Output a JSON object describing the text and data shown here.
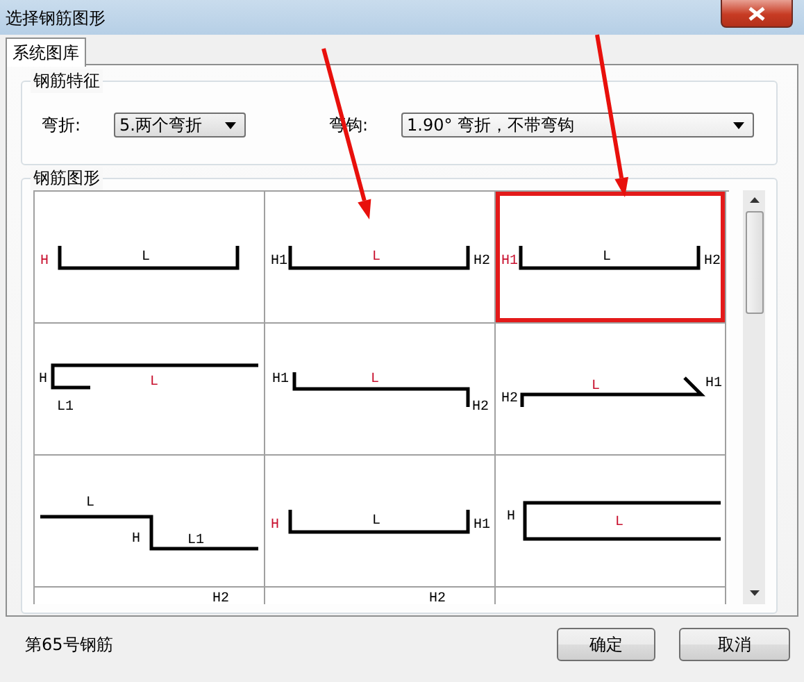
{
  "window": {
    "title": "选择钢筋图形"
  },
  "tabs": [
    {
      "label": "系统图库",
      "selected": true
    }
  ],
  "features": {
    "title": "钢筋特征",
    "bend": {
      "label": "弯折:",
      "value": "5.两个弯折"
    },
    "hook": {
      "label": "弯钩:",
      "value": "1.90° 弯折，不带弯钩"
    }
  },
  "shapes": {
    "title": "钢筋图形",
    "cells": [
      {
        "kind": "u",
        "selected": false,
        "labels": [
          {
            "text": "H",
            "highlighted": true
          },
          {
            "text": "L",
            "highlighted": false
          }
        ]
      },
      {
        "kind": "u",
        "selected": false,
        "labels": [
          {
            "text": "H1",
            "highlighted": false
          },
          {
            "text": "L",
            "highlighted": true
          },
          {
            "text": "H2",
            "highlighted": false
          }
        ]
      },
      {
        "kind": "u",
        "selected": true,
        "labels": [
          {
            "text": "H1",
            "highlighted": true
          },
          {
            "text": "L",
            "highlighted": false
          },
          {
            "text": "H2",
            "highlighted": false
          }
        ]
      },
      {
        "kind": "hook-foot",
        "selected": false,
        "labels": [
          {
            "text": "H",
            "highlighted": false
          },
          {
            "text": "L",
            "highlighted": true
          },
          {
            "text": "L1",
            "highlighted": false
          }
        ]
      },
      {
        "kind": "step-ends",
        "selected": false,
        "labels": [
          {
            "text": "H1",
            "highlighted": false
          },
          {
            "text": "L",
            "highlighted": true
          },
          {
            "text": "H2",
            "highlighted": false
          }
        ]
      },
      {
        "kind": "slant-hook",
        "selected": false,
        "labels": [
          {
            "text": "H2",
            "highlighted": false
          },
          {
            "text": "L",
            "highlighted": true
          },
          {
            "text": "H1",
            "highlighted": false
          }
        ]
      },
      {
        "kind": "z-step",
        "selected": false,
        "labels": [
          {
            "text": "L",
            "highlighted": false
          },
          {
            "text": "H",
            "highlighted": false
          },
          {
            "text": "L1",
            "highlighted": false
          }
        ]
      },
      {
        "kind": "u",
        "selected": false,
        "labels": [
          {
            "text": "H",
            "highlighted": true
          },
          {
            "text": "L",
            "highlighted": false
          },
          {
            "text": "H1",
            "highlighted": false
          }
        ]
      },
      {
        "kind": "c-open",
        "selected": false,
        "labels": [
          {
            "text": "H",
            "highlighted": false
          },
          {
            "text": "L",
            "highlighted": true
          }
        ]
      },
      {
        "kind": "partial",
        "selected": false,
        "labels": [
          {
            "text": "H2",
            "highlighted": false
          }
        ]
      },
      {
        "kind": "partial",
        "selected": false,
        "labels": [
          {
            "text": "H2",
            "highlighted": false
          }
        ]
      },
      {
        "kind": "partial",
        "selected": false
      }
    ]
  },
  "status": "第65号钢筋",
  "buttons": [
    "确定",
    "取消"
  ]
}
